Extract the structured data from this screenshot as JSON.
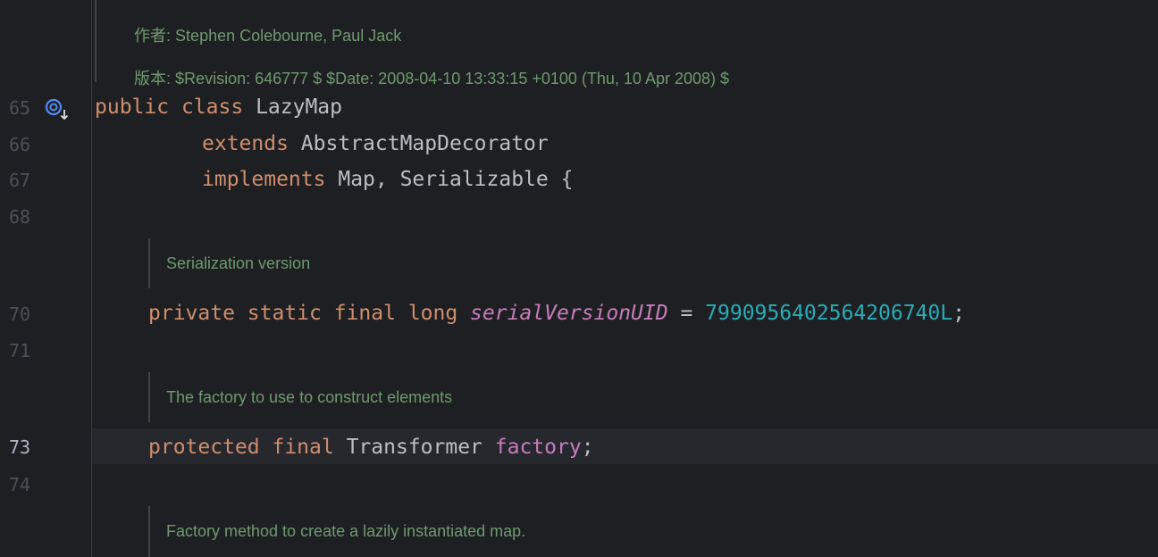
{
  "doc_header": {
    "author_label": "作者:",
    "author_value": "Stephen Colebourne, Paul Jack",
    "version_label": "版本:",
    "version_value": "$Revision: 646777 $ $Date: 2008-04-10 13:33:15 +0100 (Thu, 10 Apr 2008) $"
  },
  "line_numbers": {
    "l65": "65",
    "l66": "66",
    "l67": "67",
    "l68": "68",
    "l70": "70",
    "l71": "71",
    "l73": "73",
    "l74": "74"
  },
  "code": {
    "line65": {
      "kw1": "public",
      "kw2": "class",
      "name": "LazyMap"
    },
    "line66": {
      "kw": "extends",
      "type": "AbstractMapDecorator"
    },
    "line67": {
      "kw": "implements",
      "types": "Map, Serializable {"
    },
    "line70": {
      "kw": "private static final long",
      "field": "serialVersionUID",
      "eq": " = ",
      "num": "7990956402564206740L",
      "semi": ";"
    },
    "line73": {
      "kw": "protected final",
      "type": "Transformer",
      "field": "factory",
      "semi": ";"
    }
  },
  "docs": {
    "serialization": "Serialization version",
    "factory": "The factory to use to construct elements",
    "factory_method": "Factory method to create a lazily instantiated map."
  },
  "icons": {
    "gutter_icon": "implemented-by-icon"
  },
  "colors": {
    "background": "#1e1f22",
    "keyword": "#cf8e6d",
    "field": "#c77dbb",
    "number": "#2aacb8",
    "doc": "#6f9a6f",
    "current_line": "#26282e"
  }
}
